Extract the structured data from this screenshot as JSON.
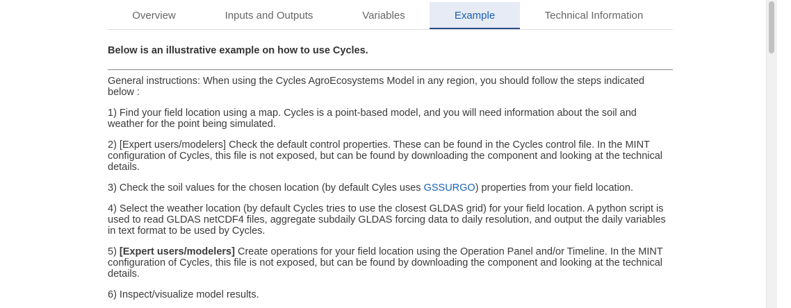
{
  "tabs": [
    {
      "label": "Overview",
      "active": false
    },
    {
      "label": "Inputs and Outputs",
      "active": false
    },
    {
      "label": "Variables",
      "active": false
    },
    {
      "label": "Example",
      "active": true
    },
    {
      "label": "Technical Information",
      "active": false
    }
  ],
  "heading": "Below is an illustrative example on how to use Cycles.",
  "instructions": {
    "general": "General instructions: When using the Cycles AgroEcosystems Model in any region, you should follow the steps indicated below :",
    "step1": "1) Find your field location using a map. Cycles is a point-based model, and you will need information about the soil and weather for the point being simulated.",
    "step2": "2) [Expert users/modelers] Check the default control properties. These can be found in the Cycles control file. In the MINT configuration of Cycles, this file is not exposed, but can be found by downloading the component and looking at the technical details.",
    "step3_before": "3) Check the soil values for the chosen location (by default Cyles uses ",
    "step3_link": "GSSURGO",
    "step3_after": ") properties from your field location.",
    "step4": "4) Select the weather location (by default Cycles tries to use the closest GLDAS grid) for your field location. A python script is used to read GLDAS netCDF4 files, aggregate subdaily GLDAS forcing data to daily resolution, and output the daily variables in text format to be used by Cycles.",
    "step5_prefix": "5) ",
    "step5_strong": "[Expert users/modelers]",
    "step5_rest": " Create operations for your field location using the Operation Panel and/or Timeline. In the MINT configuration of Cycles, this file is not exposed, but can be found by downloading the component and looking at the technical details.",
    "step6": "6) Inspect/visualize model results."
  },
  "colors": {
    "accent": "#1d5fb4",
    "active_tab_bg": "#e6ebf5",
    "link": "#1a63b5"
  }
}
